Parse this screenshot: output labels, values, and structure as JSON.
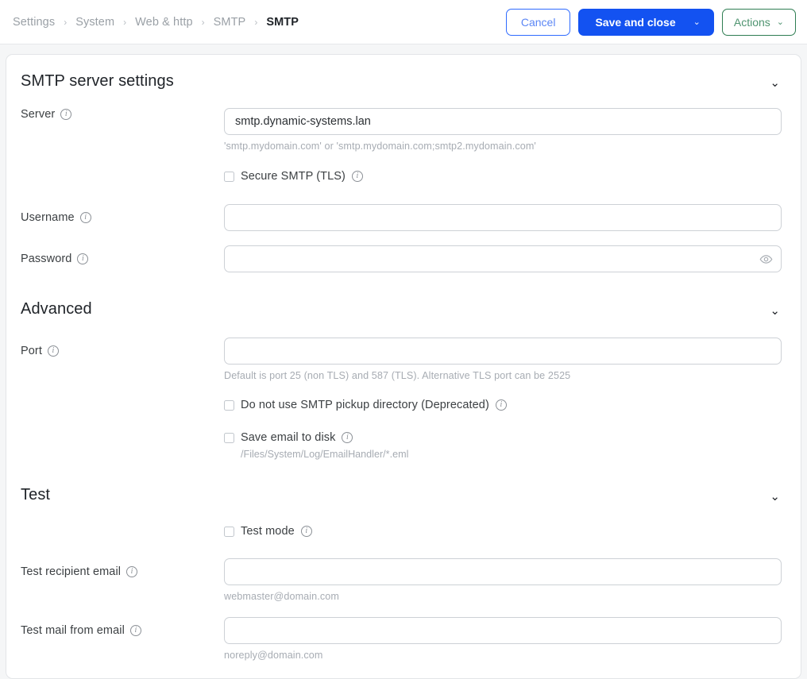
{
  "breadcrumb": {
    "separator": "›",
    "items": [
      {
        "label": "Settings",
        "active": false
      },
      {
        "label": "System",
        "active": false
      },
      {
        "label": "Web & http",
        "active": false
      },
      {
        "label": "SMTP",
        "active": false
      },
      {
        "label": "SMTP",
        "active": true
      }
    ]
  },
  "toolbar": {
    "cancel_label": "Cancel",
    "save_label": "Save and close",
    "save_chevron": "⌄",
    "actions_label": "Actions",
    "actions_chevron": "⌄",
    "colors": {
      "primary": "#1352f1",
      "cancel_border": "#2f6bff",
      "actions_border": "#2e7d52"
    }
  },
  "sections": {
    "server": {
      "title": "SMTP server settings",
      "chevron": "⌄",
      "server": {
        "label": "Server",
        "info": "i",
        "value": "smtp.dynamic-systems.lan",
        "placeholder": "",
        "hint": "'smtp.mydomain.com' or 'smtp.mydomain.com;smtp2.mydomain.com'"
      },
      "secure_tls": {
        "label": "Secure SMTP (TLS)",
        "info": "i",
        "checked": false
      },
      "username": {
        "label": "Username",
        "info": "i",
        "value": "",
        "placeholder": ""
      },
      "password": {
        "label": "Password",
        "info": "i",
        "value": "",
        "placeholder": "",
        "reveal_icon": "eye-icon"
      }
    },
    "advanced": {
      "title": "Advanced",
      "chevron": "⌄",
      "port": {
        "label": "Port",
        "info": "i",
        "value": "",
        "placeholder": "",
        "hint": "Default is port 25 (non TLS) and 587 (TLS). Alternative TLS port can be 2525"
      },
      "no_pickup_dir": {
        "label": "Do not use SMTP pickup directory (Deprecated)",
        "info": "i",
        "checked": false
      },
      "save_to_disk": {
        "label": "Save email to disk",
        "info": "i",
        "checked": false,
        "hint": "/Files/System/Log/EmailHandler/*.eml"
      }
    },
    "test": {
      "title": "Test",
      "chevron": "⌄",
      "test_mode": {
        "label": "Test mode",
        "info": "i",
        "checked": false
      },
      "recipient": {
        "label": "Test recipient email",
        "info": "i",
        "value": "",
        "placeholder": "",
        "hint": "webmaster@domain.com"
      },
      "mail_from": {
        "label": "Test mail from email",
        "info": "i",
        "value": "",
        "placeholder": "",
        "hint": "noreply@domain.com"
      }
    }
  }
}
